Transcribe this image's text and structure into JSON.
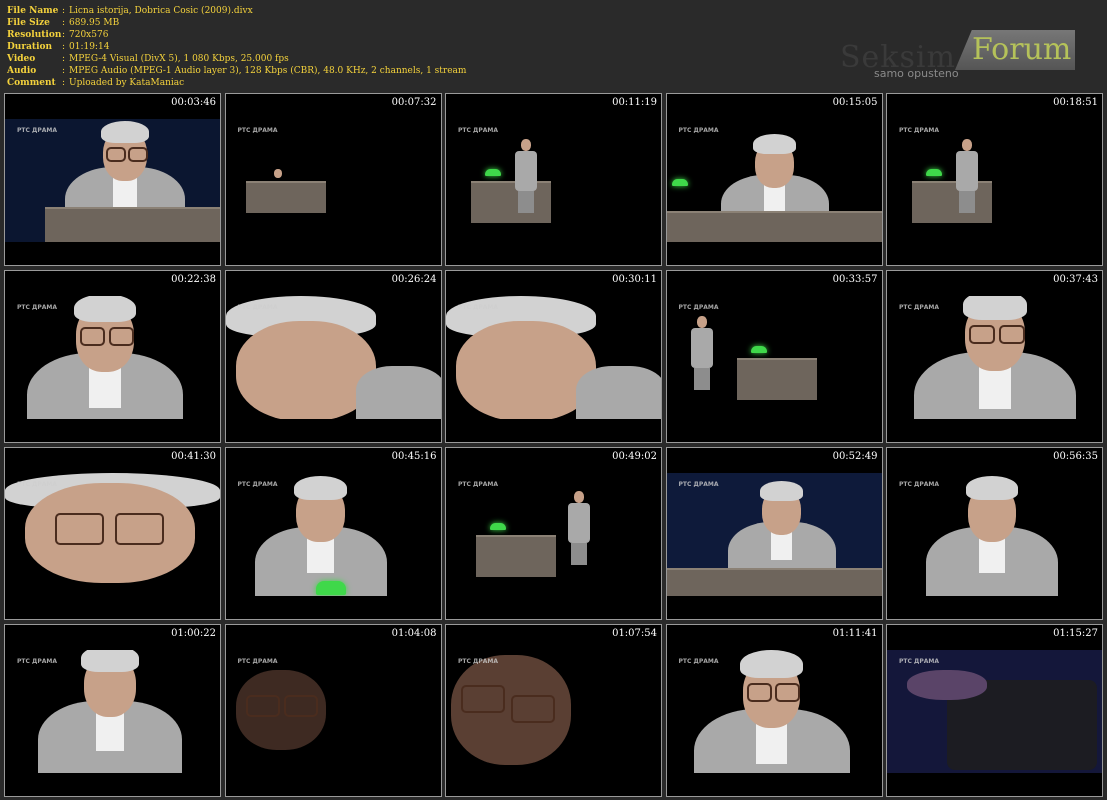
{
  "file_info": [
    {
      "key": "File Name",
      "value": "Licna istorija, Dobrica Cosic (2009).divx"
    },
    {
      "key": "File Size",
      "value": "689.95 MB"
    },
    {
      "key": "Resolution",
      "value": "720x576"
    },
    {
      "key": "Duration",
      "value": "01:19:14"
    },
    {
      "key": "Video",
      "value": "MPEG-4 Visual (DivX 5), 1 080 Kbps, 25.000 fps"
    },
    {
      "key": "Audio",
      "value": "MPEG Audio (MPEG-1 Audio layer 3), 128 Kbps (CBR), 48.0 KHz, 2 channels, 1 stream"
    },
    {
      "key": "Comment",
      "value": "Uploaded by KataManiac"
    }
  ],
  "logo": {
    "word": "Forum",
    "subtitle": "samo opusteno"
  },
  "watermark": "РТС ДРАМА",
  "colors": {
    "info_text": "#f4d23c",
    "background": "#2a2a2a",
    "lamp": "#3fd84a"
  },
  "thumbnails": [
    {
      "time": "00:03:46",
      "scene": "desk-close"
    },
    {
      "time": "00:07:32",
      "scene": "stage-wide-desk"
    },
    {
      "time": "00:11:19",
      "scene": "stage-standing"
    },
    {
      "time": "00:15:05",
      "scene": "desk-medium"
    },
    {
      "time": "00:18:51",
      "scene": "stage-standing"
    },
    {
      "time": "00:22:38",
      "scene": "portrait-down"
    },
    {
      "time": "00:26:24",
      "scene": "extreme-close"
    },
    {
      "time": "00:30:11",
      "scene": "extreme-close"
    },
    {
      "time": "00:33:57",
      "scene": "stage-walking"
    },
    {
      "time": "00:37:43",
      "scene": "portrait-glasses"
    },
    {
      "time": "00:41:30",
      "scene": "extreme-close-glasses"
    },
    {
      "time": "00:45:16",
      "scene": "standing-lamp"
    },
    {
      "time": "00:49:02",
      "scene": "stage-standing-right"
    },
    {
      "time": "00:52:49",
      "scene": "desk-typewriter"
    },
    {
      "time": "00:56:35",
      "scene": "portrait-dark"
    },
    {
      "time": "01:00:22",
      "scene": "portrait-dark-face"
    },
    {
      "time": "01:04:08",
      "scene": "dark-glasses"
    },
    {
      "time": "01:07:54",
      "scene": "dark-glasses-down"
    },
    {
      "time": "01:11:41",
      "scene": "portrait-glasses-front"
    },
    {
      "time": "01:15:27",
      "scene": "typewriter-hands"
    }
  ]
}
